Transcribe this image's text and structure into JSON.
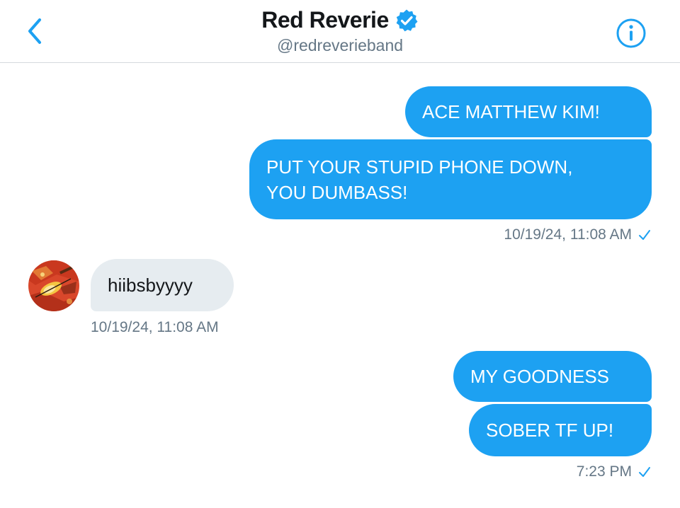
{
  "header": {
    "title": "Red Reverie",
    "handle": "@redreverieband",
    "back_icon": "chevron-left-icon",
    "verified_icon": "verified-badge-icon",
    "info_icon": "info-icon",
    "accent_color": "#1da1f2"
  },
  "messages": [
    {
      "direction": "outgoing",
      "text": "ACE MATTHEW KIM!"
    },
    {
      "direction": "outgoing",
      "text": "PUT YOUR STUPID PHONE DOWN,\nYOU DUMBASS!"
    },
    {
      "direction": "incoming",
      "text": "hiibsbyyyy"
    },
    {
      "direction": "outgoing",
      "text": "MY GOODNESS"
    },
    {
      "direction": "outgoing",
      "text": "SOBER TF UP!"
    }
  ],
  "timestamps": {
    "group1": "10/19/24, 11:08 AM",
    "group2": "10/19/24, 11:08 AM",
    "group3": "7:23 PM"
  },
  "colors": {
    "outgoing_bubble": "#1da1f2",
    "incoming_bubble": "#e6ecf0",
    "meta_text": "#657786"
  }
}
